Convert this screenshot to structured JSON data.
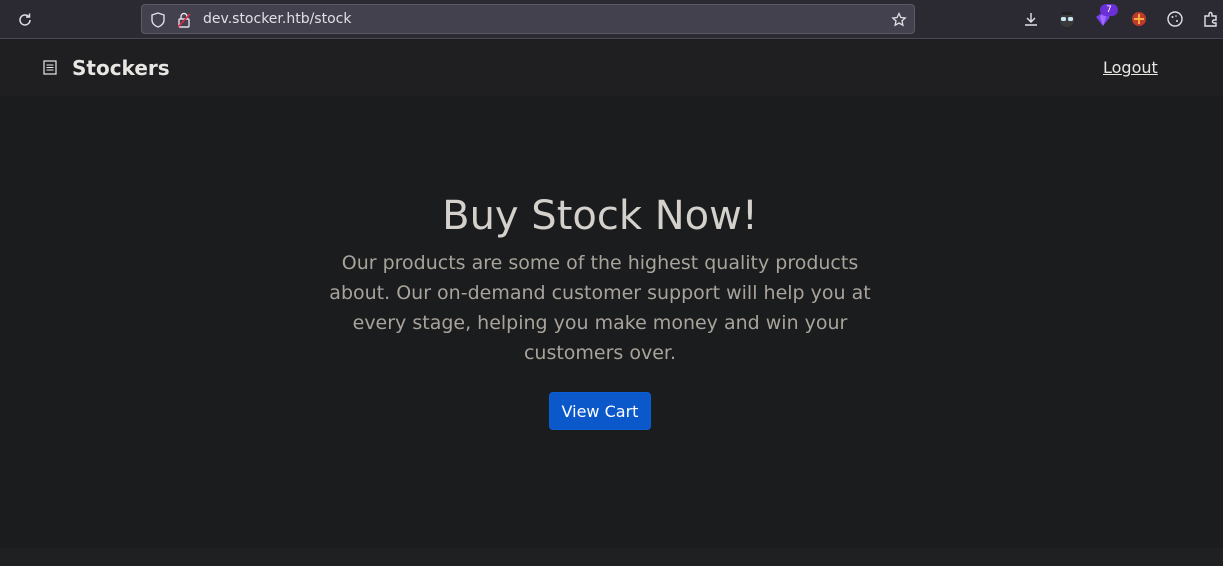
{
  "browser": {
    "url": "dev.stocker.htb/stock",
    "extension_badge": "7",
    "icons": [
      "reload-icon",
      "shield-icon",
      "lock-insecure-icon",
      "bookmark-star-icon",
      "download-icon",
      "extension-spy-icon",
      "extension-purple-icon",
      "extension-red-icon",
      "cookie-icon",
      "extensions-puzzle-icon"
    ]
  },
  "navbar": {
    "brand": "Stockers",
    "logout": "Logout"
  },
  "hero": {
    "title": "Buy Stock Now!",
    "description": "Our products are some of the highest quality products about. Our on-demand customer support will help you at every stage, helping you make money and win your customers over.",
    "button": "View Cart"
  },
  "colors": {
    "accent": "#0a58ca",
    "background": "#1b1c1e",
    "navbar": "#1f1f21"
  }
}
